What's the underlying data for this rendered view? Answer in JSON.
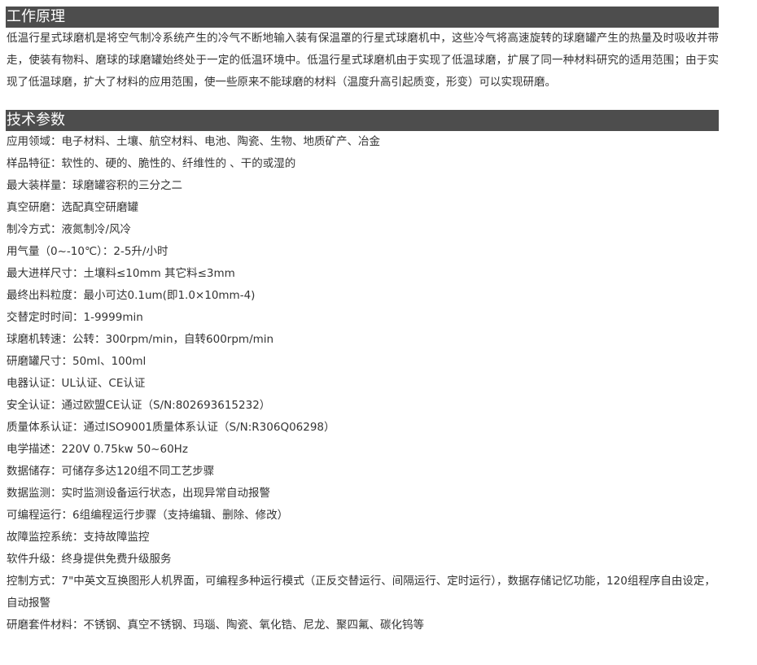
{
  "sections": {
    "principle": {
      "title": "工作原理",
      "text": "低温行星式球磨机是将空气制冷系统产生的冷气不断地输入装有保温罩的行星式球磨机中，这些冷气将高速旋转的球磨罐产生的热量及时吸收并带走，使装有物料、磨球的球磨罐始终处于一定的低温环境中。低温行星式球磨机由于实现了低温球磨，扩展了同一种材料研究的适用范围；由于实现了低温球磨，扩大了材料的应用范围，使一些原来不能球磨的材料（温度升高引起质变，形变）可以实现研磨。"
    },
    "specs": {
      "title": "技术参数",
      "rows": [
        "应用领域：电子材料、土壤、航空材料、电池、陶瓷、生物、地质矿产、冶金",
        "样品特征：软性的、硬的、脆性的、纤维性的 、干的或湿的",
        "最大装样量：球磨罐容积的三分之二",
        "真空研磨：选配真空研磨罐",
        "制冷方式：液氮制冷/风冷",
        "用气量（0~-10℃）：2-5升/小时",
        "最大进样尺寸：土壤料≤10mm 其它料≤3mm",
        "最终出料粒度：最小可达0.1um(即1.0×10mm-4)",
        "交替定时时间：1-9999min",
        "球磨机转速：公转：300rpm/min，自转600rpm/min",
        "研磨罐尺寸：50ml、100ml",
        "电器认证：UL认证、CE认证",
        "安全认证：通过欧盟CE认证（S/N:802693615232）",
        "质量体系认证：通过ISO9001质量体系认证（S/N:R306Q06298）",
        "电学描述：220V  0.75kw  50~60Hz",
        "数据储存：可储存多达120组不同工艺步骤",
        "数据监测：实时监测设备运行状态，出现异常自动报警",
        "可编程运行：6组编程运行步骤（支持编辑、删除、修改）",
        "故障监控系统：支持故障监控",
        "软件升级：终身提供免费升级服务",
        "控制方式：7\"中英文互换图形人机界面，可编程多种运行模式（正反交替运行、间隔运行、定时运行），数据存储记忆功能，120组程序自由设定，自动报警",
        "研磨套件材料：不锈钢、真空不锈钢、玛瑙、陶瓷、氧化锆、尼龙、聚四氟、碳化钨等"
      ]
    }
  }
}
